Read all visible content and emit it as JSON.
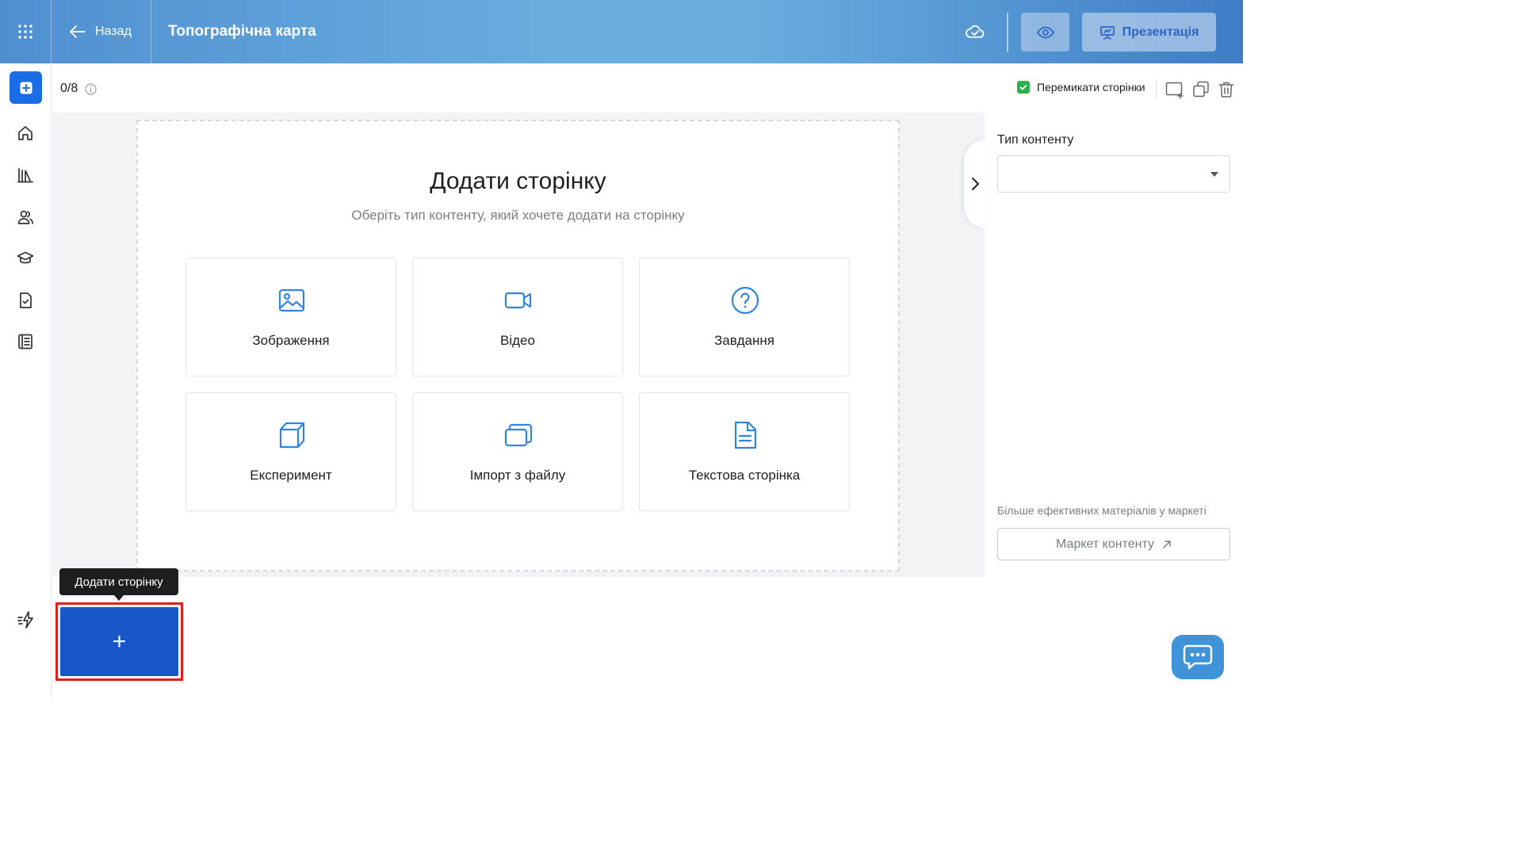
{
  "header": {
    "back_label": "Назад",
    "title": "Топографічна карта",
    "present_label": "Презентація"
  },
  "toolbar": {
    "counter": "0/8",
    "switch_pages_label": "Перемикати сторінки",
    "switch_pages_checked": true
  },
  "canvas": {
    "title": "Додати сторінку",
    "subtitle": "Оберіть тип контенту, який хочете додати на сторінку",
    "cards": [
      {
        "label": "Зображення",
        "icon": "image-icon"
      },
      {
        "label": "Відео",
        "icon": "video-icon"
      },
      {
        "label": "Завдання",
        "icon": "question-icon"
      },
      {
        "label": "Експеримент",
        "icon": "cube-icon"
      },
      {
        "label": "Імпорт з файлу",
        "icon": "import-file-icon"
      },
      {
        "label": "Текстова сторінка",
        "icon": "text-page-icon"
      }
    ]
  },
  "panel": {
    "content_type_label": "Тип контенту",
    "content_type_value": "",
    "market_note": "Більше ефективних матеріалів у маркеті",
    "market_button": "Маркет контенту"
  },
  "bottom": {
    "tooltip": "Додати сторінку",
    "add_button": "+"
  },
  "colors": {
    "accent": "#1b6de6",
    "add_button": "#1757c9",
    "highlight": "#e0201f",
    "checkbox": "#2bb24c",
    "icon_blue": "#2f86e0"
  }
}
